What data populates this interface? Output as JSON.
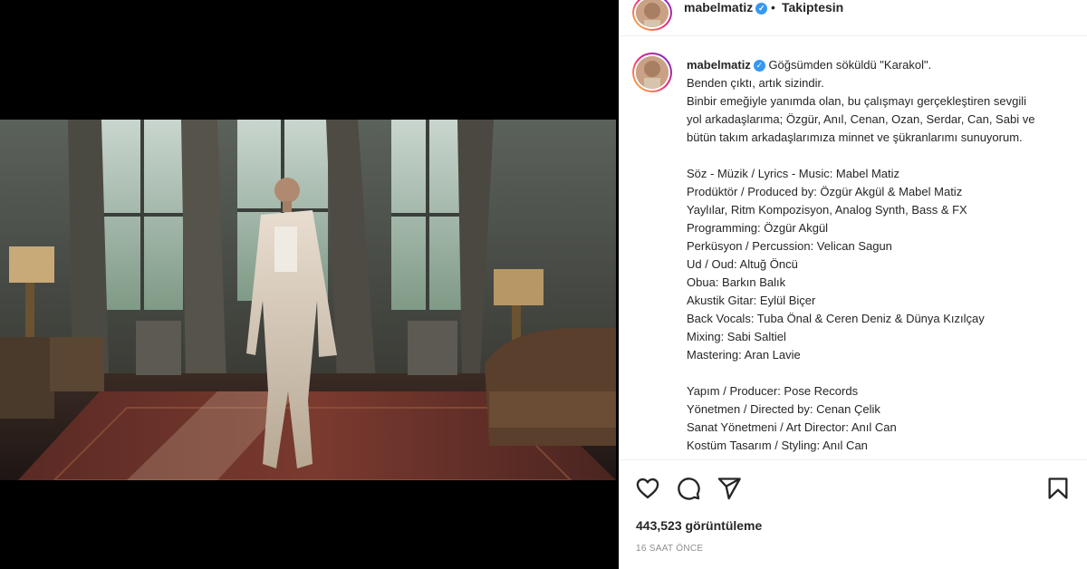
{
  "post": {
    "username": "mabelmatiz",
    "follow_status": "Takiptesin",
    "dot": "•"
  },
  "caption": {
    "lines": [
      "Göğsümden söküldü \"Karakol\".",
      "Benden çıktı, artık sizindir.",
      "Binbir emeğiyle yanımda olan, bu çalışmayı gerçekleştiren sevgili",
      "yol arkadaşlarıma; Özgür, Anıl, Cenan, Ozan, Serdar, Can, Sabi ve",
      "bütün takım arkadaşlarımıza minnet ve şükranlarımı sunuyorum.",
      "",
      "Söz - Müzik / Lyrics - Music: Mabel Matiz",
      "Prodüktör / Produced by: Özgür Akgül & Mabel Matiz",
      "Yaylılar, Ritm Kompozisyon, Analog Synth, Bass & FX",
      "Programming: Özgür Akgül",
      "Perküsyon / Percussion: Velican Sagun",
      "Ud / Oud: Altuğ Öncü",
      "Obua: Barkın Balık",
      "Akustik Gitar: Eylül Biçer",
      "Back Vocals: Tuba Önal & Ceren Deniz & Dünya Kızılçay",
      "Mixing: Sabi Saltiel",
      "Mastering: Aran Lavie",
      "",
      "Yapım / Producer: Pose Records",
      "Yönetmen / Directed by: Cenan Çelik",
      "Sanat Yönetmeni / Art Director: Anıl Can",
      "Kostüm Tasarım / Styling: Anıl Can"
    ]
  },
  "stats": {
    "views": "443,523 görüntüleme",
    "time_ago": "16 SAAT ÖNCE"
  },
  "icons": {
    "like": "heart-icon",
    "comment": "comment-icon",
    "share": "send-icon",
    "save": "bookmark-icon",
    "verified": "verified-badge-icon"
  },
  "colors": {
    "verified": "#3897f0",
    "text": "#262626",
    "muted": "#8e8e8e"
  }
}
